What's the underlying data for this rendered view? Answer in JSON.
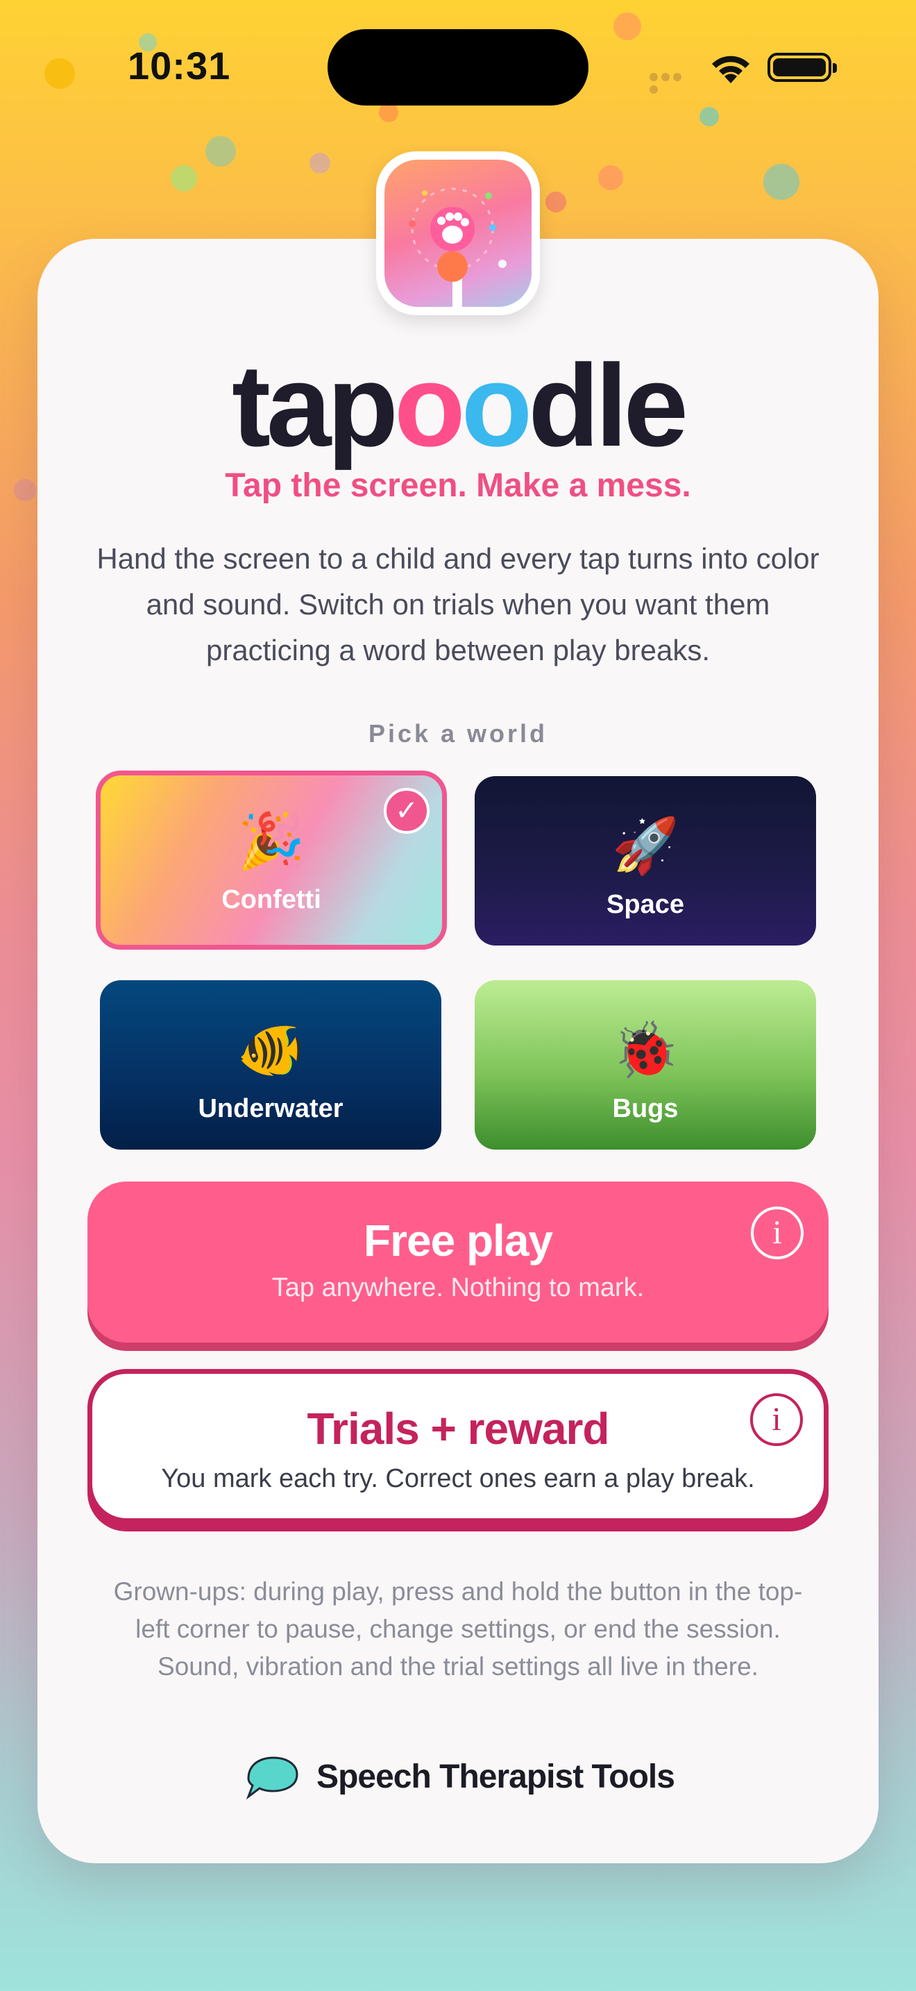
{
  "status_bar": {
    "time": "10:31"
  },
  "app": {
    "wordmark": {
      "part1": "tap",
      "o1": "o",
      "o2": "o",
      "part2": "dle"
    },
    "tagline": "Tap the screen. Make a mess.",
    "intro": "Hand the screen to a child and every tap turns into color and sound. Switch on trials when you want them practicing a word between play breaks."
  },
  "worlds": {
    "section_label": "Pick a world",
    "items": [
      {
        "label": "Confetti",
        "emoji": "🎉",
        "selected": true
      },
      {
        "label": "Space",
        "emoji": "🚀",
        "selected": false
      },
      {
        "label": "Underwater",
        "emoji": "🐠",
        "selected": false
      },
      {
        "label": "Bugs",
        "emoji": "🐞",
        "selected": false
      }
    ]
  },
  "modes": {
    "free_play": {
      "title": "Free play",
      "subtitle": "Tap anywhere. Nothing to mark.",
      "info_icon": "i"
    },
    "trials": {
      "title": "Trials + reward",
      "subtitle": "You mark each try. Correct ones earn a play break.",
      "info_icon": "i"
    }
  },
  "footnote": "Grown-ups: during play, press and hold the button in the top-left corner to pause, change settings, or end the session. Sound, vibration and the trial settings all live in there.",
  "brand": {
    "name": "Speech Therapist Tools",
    "icon": "speech-bubble-icon"
  },
  "colors": {
    "accent": "#ff5e8c",
    "accent_dark": "#c4235d",
    "tagline": "#ef4f83",
    "blue_o": "#3bb8ee"
  }
}
